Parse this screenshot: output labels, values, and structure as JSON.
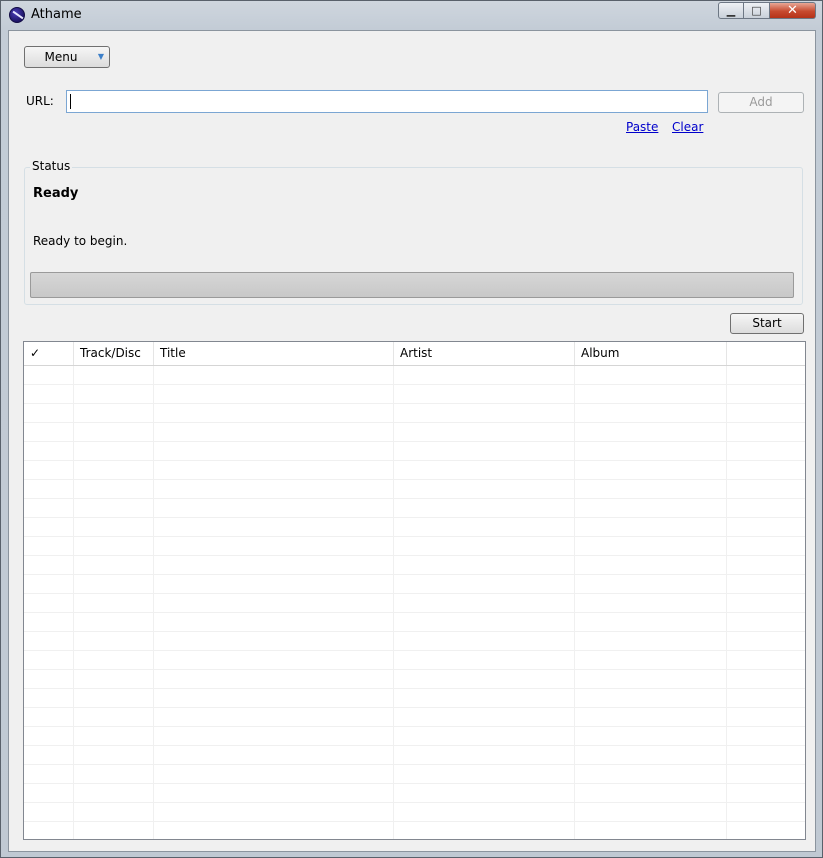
{
  "window": {
    "title": "Athame",
    "controls": {
      "minimize": "▁",
      "maximize": "□",
      "close": "✕"
    }
  },
  "toolbar": {
    "menu_label": "Menu",
    "menu_arrow": "▼"
  },
  "url_bar": {
    "label": "URL:",
    "value": "",
    "add_label": "Add",
    "paste_link": "Paste",
    "clear_link": "Clear"
  },
  "status": {
    "group_label": "Status",
    "title": "Ready",
    "message": "Ready to begin.",
    "progress": 0
  },
  "start_label": "Start",
  "table": {
    "columns": [
      "✓",
      "Track/Disc",
      "Title",
      "Artist",
      "Album",
      ""
    ],
    "rows": []
  },
  "colors": {
    "link": "#0000cc",
    "progress_fill": "#06b025",
    "input_border": "#7ba6d3"
  },
  "icons": [
    "app-logo-icon",
    "minimize-icon",
    "maximize-icon",
    "close-icon",
    "dropdown-arrow-icon"
  ]
}
